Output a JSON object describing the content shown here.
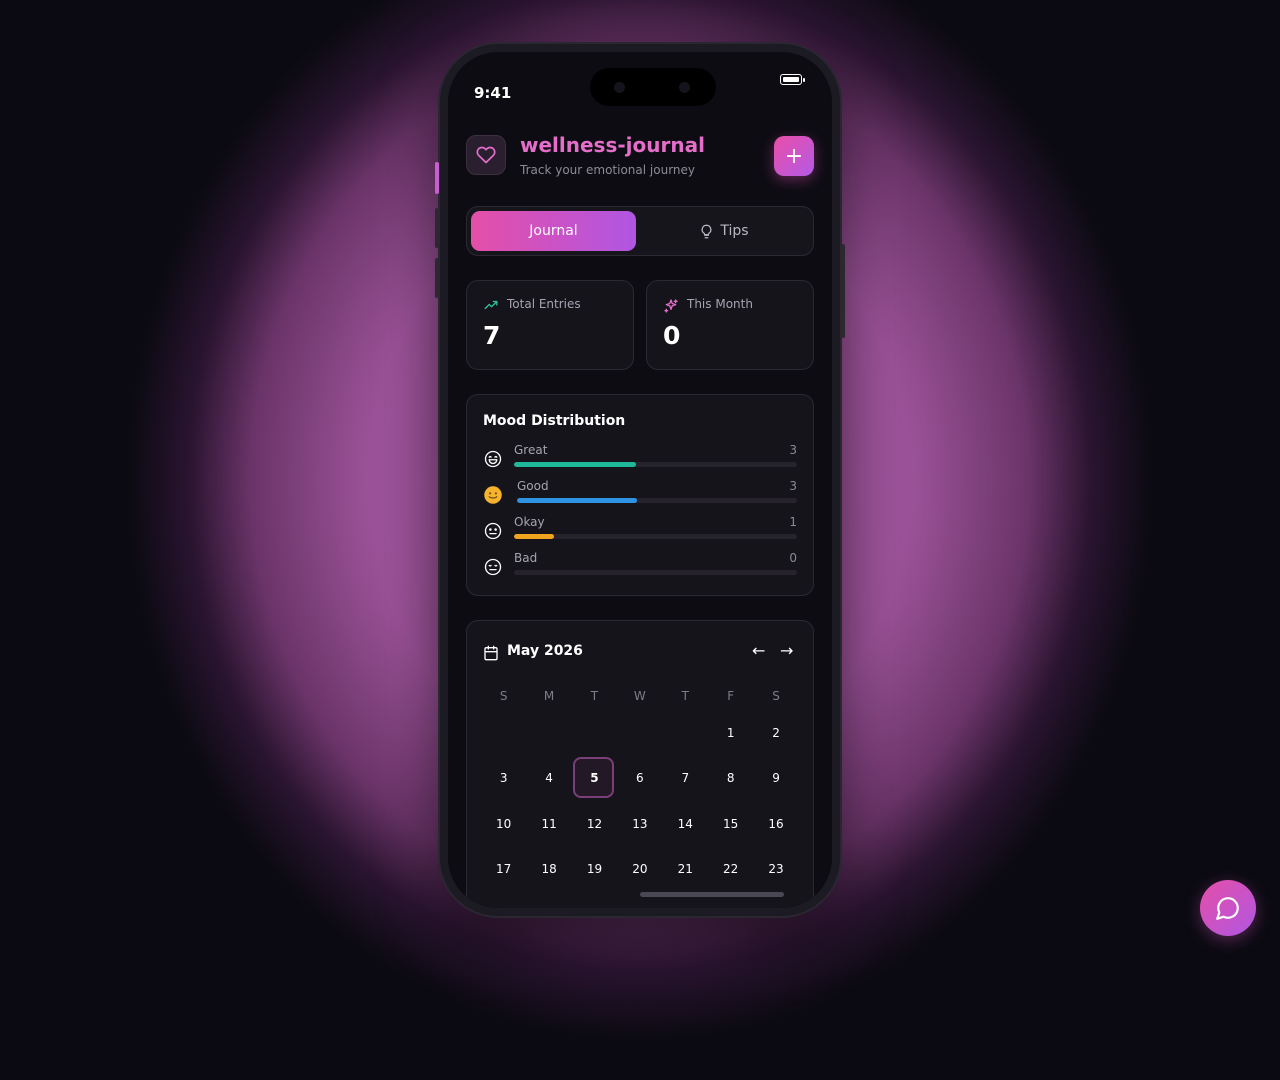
{
  "status": {
    "time": "9:41"
  },
  "app": {
    "title": "wellness-journal",
    "subtitle": "Track your emotional journey",
    "add_label": "+"
  },
  "tabs": [
    {
      "label": "Journal"
    },
    {
      "label": "Tips"
    }
  ],
  "stats": [
    {
      "label": "Total Entries",
      "value": "7",
      "icon": "trending-up-icon",
      "color": "#2fc49a"
    },
    {
      "label": "This Month",
      "value": "0",
      "icon": "sparkles-icon",
      "color": "#e46ec9"
    }
  ],
  "mood": {
    "title": "Mood Distribution",
    "items": [
      {
        "name": "Great",
        "count": "3",
        "fraction": 0.43,
        "color": "#1fb89a",
        "icon": "grin-icon"
      },
      {
        "name": "Good",
        "count": "3",
        "fraction": 0.43,
        "color": "#2e93e2",
        "icon": "smile-emoji-icon"
      },
      {
        "name": "Okay",
        "count": "1",
        "fraction": 0.14,
        "color": "#f0a51e",
        "icon": "neutral-face-icon"
      },
      {
        "name": "Bad",
        "count": "0",
        "fraction": 0.0,
        "color": "#8c8a96",
        "icon": "sad-face-icon"
      }
    ]
  },
  "calendar": {
    "month": "May 2026",
    "prev_label": "←",
    "next_label": "→",
    "weekdays": [
      "S",
      "M",
      "T",
      "W",
      "T",
      "F",
      "S"
    ],
    "weeks": [
      [
        "",
        "",
        "",
        "",
        "",
        "1",
        "2"
      ],
      [
        "3",
        "4",
        "5",
        "6",
        "7",
        "8",
        "9"
      ],
      [
        "10",
        "11",
        "12",
        "13",
        "14",
        "15",
        "16"
      ],
      [
        "17",
        "18",
        "19",
        "20",
        "21",
        "22",
        "23"
      ]
    ],
    "today": "5"
  },
  "colors": {
    "accent": "#e46ec9",
    "gradient_start": "#e54fa8",
    "gradient_end": "#b056e2"
  }
}
